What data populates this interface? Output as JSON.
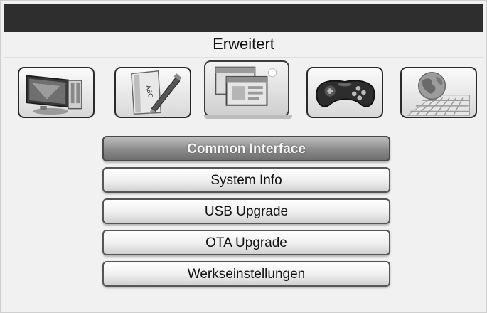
{
  "title": "Erweitert",
  "tabs": [
    {
      "icon": "tv-monitor-icon"
    },
    {
      "icon": "abc-book-pen-icon"
    },
    {
      "icon": "windows-panels-icon",
      "selected": true
    },
    {
      "icon": "gamepad-icon"
    },
    {
      "icon": "globe-network-icon"
    }
  ],
  "menu": {
    "items": [
      {
        "label": "Common Interface",
        "active": true
      },
      {
        "label": "System Info"
      },
      {
        "label": "USB Upgrade"
      },
      {
        "label": "OTA Upgrade"
      },
      {
        "label": "Werkseinstellungen"
      }
    ]
  }
}
